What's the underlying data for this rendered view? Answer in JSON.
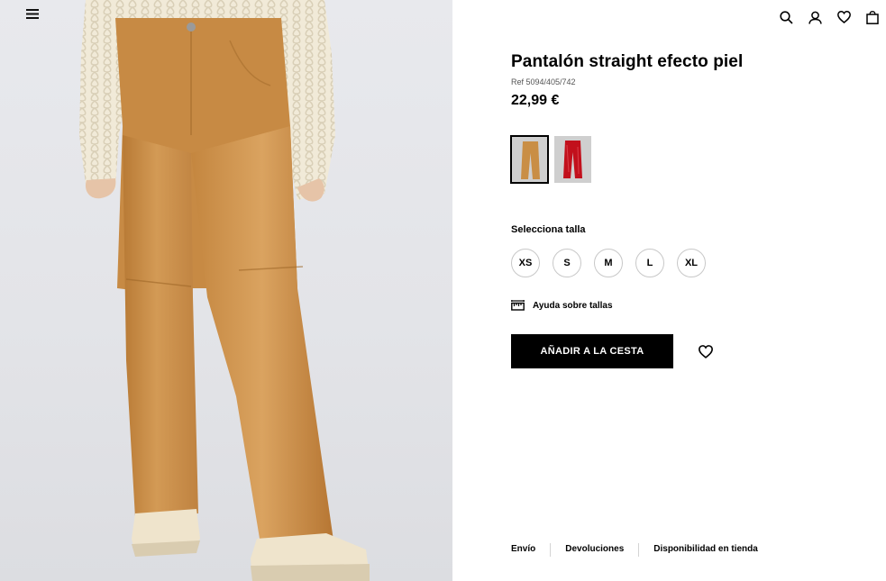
{
  "product": {
    "title": "Pantalón straight efecto piel",
    "ref": "Ref 5094/405/742",
    "price": "22,99 €"
  },
  "colors": {
    "swatches": [
      {
        "name": "camel",
        "hex": "#c98e45",
        "selected": true
      },
      {
        "name": "red",
        "hex": "#c2101c",
        "selected": false
      }
    ]
  },
  "sizes": {
    "label": "Selecciona talla",
    "options": [
      "XS",
      "S",
      "M",
      "L",
      "XL"
    ]
  },
  "size_help": {
    "label": "Ayuda sobre tallas",
    "icon": "ruler-icon"
  },
  "actions": {
    "add_to_cart": "AÑADIR A LA CESTA",
    "wishlist_icon": "heart-icon"
  },
  "header_icons": [
    "search-icon",
    "user-icon",
    "heart-icon",
    "bag-icon"
  ],
  "footer": {
    "links": [
      "Envío",
      "Devoluciones",
      "Disponibilidad en tienda"
    ]
  }
}
